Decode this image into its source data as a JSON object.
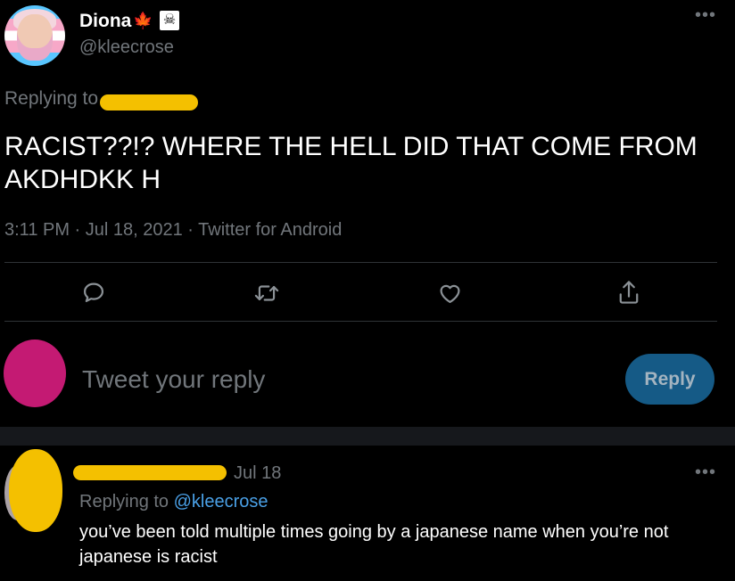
{
  "main_tweet": {
    "author": {
      "display_name": "Diona",
      "name_emoji_1": "🍁",
      "name_emoji_2": "☠",
      "handle": "@kleecrose"
    },
    "more_icon": "•••",
    "replying_prefix": "Replying to",
    "text": "RACIST??!? WHERE THE HELL DID THAT COME FROM\nAKDHDKK H",
    "meta": "3:11 PM · Jul 18, 2021 · Twitter for Android",
    "actions": {
      "reply_icon": "reply-icon",
      "retweet_icon": "retweet-icon",
      "like_icon": "heart-icon",
      "share_icon": "share-icon"
    }
  },
  "composer": {
    "placeholder": "Tweet your reply",
    "reply_button": "Reply"
  },
  "second_tweet": {
    "date": "Jul 18",
    "more_icon": "•••",
    "replying_prefix": "Replying to",
    "replying_handle": "@kleecrose",
    "text": "you’ve been told multiple times going by a japanese name when you’re not japanese is racist"
  },
  "colors": {
    "background": "#000000",
    "secondary_text": "#71767b",
    "link": "#4aa0e6",
    "reply_button": "#155a86",
    "redaction": "#f4c000",
    "composer_avatar": "#c41a73"
  }
}
